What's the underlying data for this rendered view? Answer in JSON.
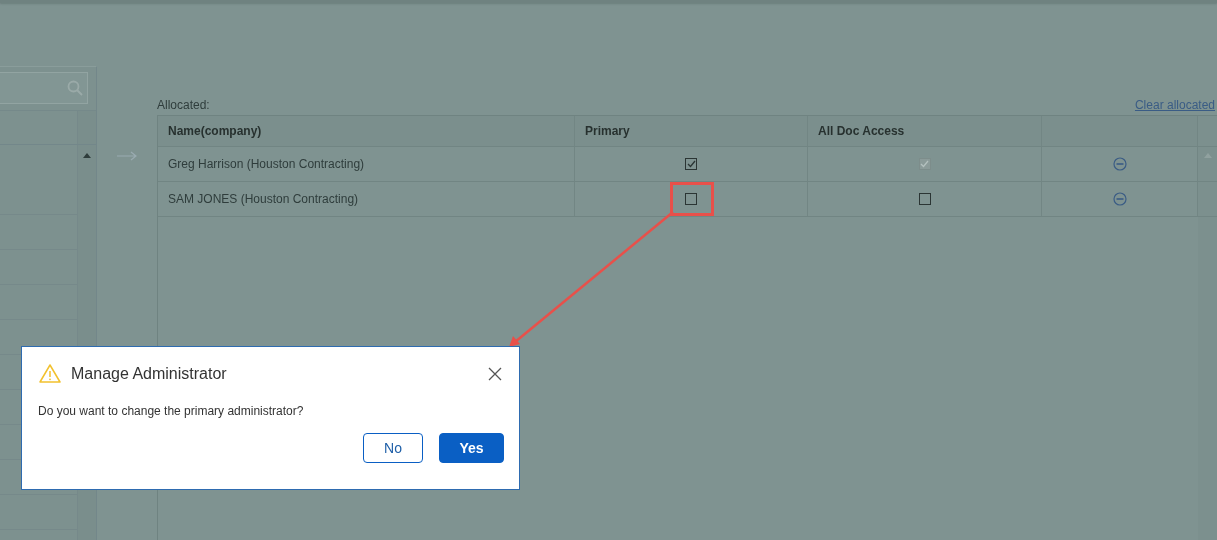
{
  "allocated": {
    "label": "Allocated:",
    "clear_link": "Clear allocated",
    "columns": [
      "Name(company)",
      "Primary",
      "All Doc Access"
    ],
    "rows": [
      {
        "name": "Greg Harrison (Houston Contracting)",
        "primary": {
          "checked": true,
          "disabled": false
        },
        "all_doc_access": {
          "checked": true,
          "disabled": true
        }
      },
      {
        "name": "SAM JONES (Houston Contracting)",
        "primary": {
          "checked": false,
          "disabled": false
        },
        "all_doc_access": {
          "checked": false,
          "disabled": false
        }
      }
    ]
  },
  "dialog": {
    "title": "Manage Administrator",
    "message": "Do you want to change the primary administrator?",
    "buttons": [
      {
        "label": "No",
        "kind": "secondary"
      },
      {
        "label": "Yes",
        "kind": "primary"
      }
    ]
  }
}
